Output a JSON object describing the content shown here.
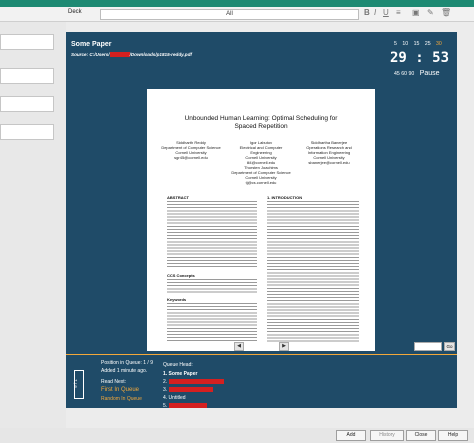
{
  "browser": {
    "deck_label": "Deck",
    "deck_value": "All",
    "format_icons": [
      "bold-icon",
      "italic-icon",
      "underline-icon",
      "list-icon",
      "picture-icon",
      "trash-icon"
    ]
  },
  "main": {
    "title": "Some Paper",
    "source_label": "Source:",
    "source_prefix": "C:/Users/",
    "source_suffix": "/Downloads/p1815-reddy.pdf",
    "speeds": [
      "5",
      "10",
      "15",
      "25",
      "30"
    ],
    "speed_current_index": 4,
    "timer": "29 : 53",
    "adjust": [
      "45",
      "60",
      "90"
    ],
    "pause_label": "Pause"
  },
  "pdf": {
    "title_line1": "Unbounded Human Learning: Optimal Scheduling for",
    "title_line2": "Spaced Repetition",
    "authors": [
      {
        "name": "Siddharth Reddy",
        "aff": "Department of Computer Science",
        "univ": "Cornell University",
        "email": "sgr45@cornell.edu"
      },
      {
        "name": "Igor Labutov",
        "aff": "Electrical and Computer Engineering",
        "univ": "Cornell University",
        "email": "iil4@cornell.edu"
      },
      {
        "name": "Siddhartha Banerjee",
        "aff": "Operations Research and Information Engineering",
        "univ": "Cornell University",
        "email": "sbanerjee@cornell.edu"
      }
    ],
    "author4": {
      "name": "Thorsten Joachims",
      "aff": "Department of Computer Science",
      "univ": "Cornell University",
      "email": "tj@cs.cornell.edu"
    },
    "abstract_heading": "ABSTRACT",
    "ccs_heading": "CCS Concepts",
    "keywords_heading": "Keywords",
    "intro_heading": "1.  INTRODUCTION",
    "page_indicator": "1 / 10",
    "go_label": "Go"
  },
  "queue": {
    "position": "Position in Queue: 1 / 9",
    "added": "Added 1 minute ago.",
    "read_next_label": "Read Next:",
    "first_in_queue": "First In Queue",
    "random_in_queue": "Random In Queue",
    "head_label": "Queue Head:",
    "items": [
      "1. Some Paper",
      "2.",
      "3.",
      "4. Untitled",
      "5."
    ],
    "count_vertical": "9 / 1"
  },
  "footer": {
    "add": "Add",
    "history": "History",
    "close": "Close",
    "help": "Help"
  },
  "colors": {
    "accent_green": "#1e8a73",
    "panel_blue": "#1f4b68",
    "orange": "#f3a83a",
    "redaction": "#d42020"
  }
}
